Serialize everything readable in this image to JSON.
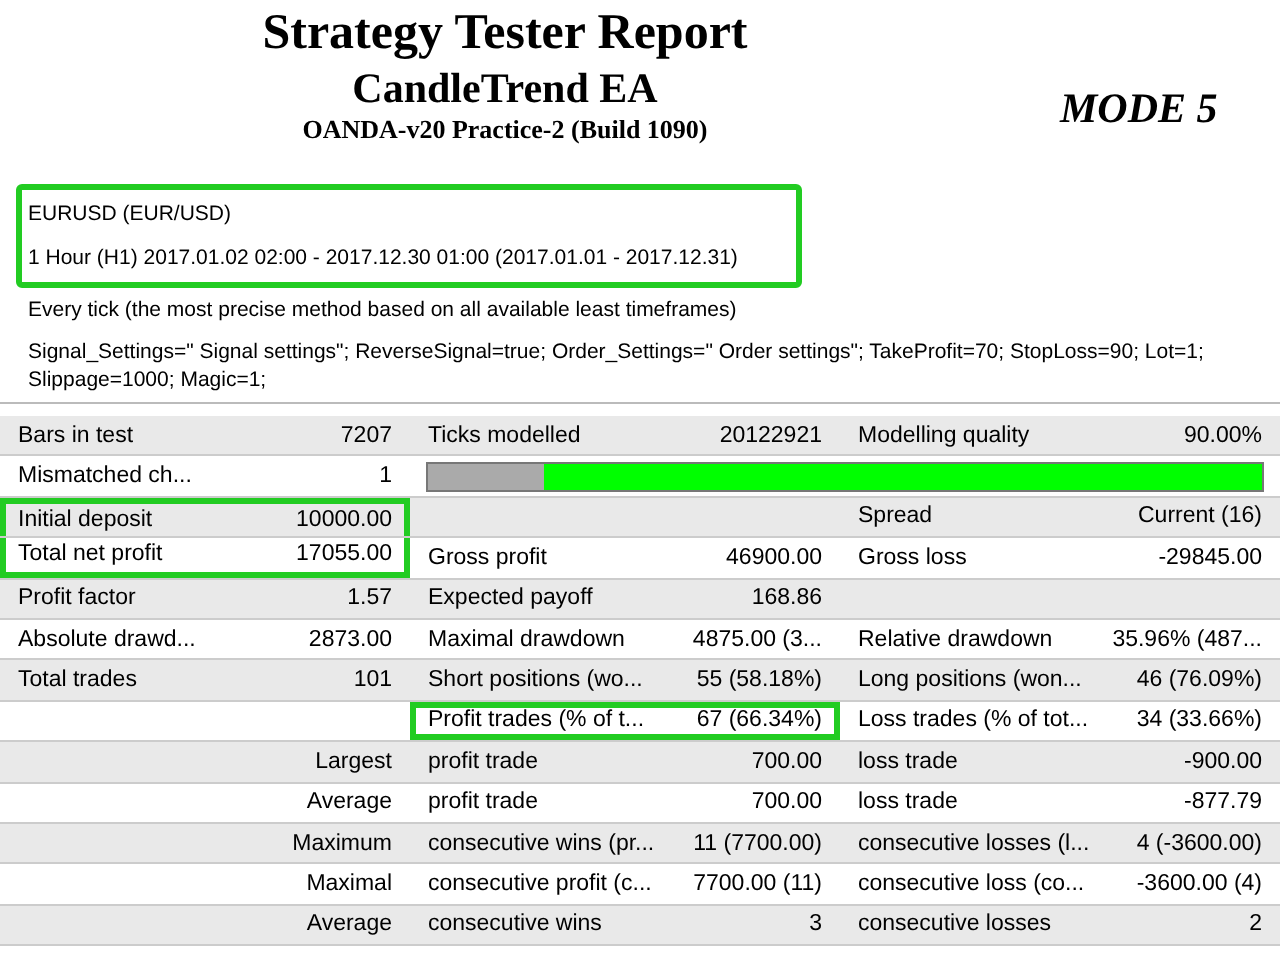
{
  "title": "Strategy Tester Report",
  "subtitle": "CandleTrend EA",
  "server": "OANDA-v20 Practice-2 (Build 1090)",
  "mode": "MODE 5",
  "info": [
    {
      "text": "EURUSD (EUR/USD)",
      "boxed": true
    },
    {
      "text": "1 Hour (H1) 2017.01.02 02:00 - 2017.12.30 01:00 (2017.01.01 - 2017.12.31)",
      "boxed": true
    },
    {
      "text": "Every tick (the most precise method based on all available least timeframes)",
      "boxed": false
    }
  ],
  "parameters": "Signal_Settings=\" Signal settings\"; ReverseSignal=true; Order_Settings=\" Order settings\"; TakeProfit=70; StopLoss=90; Lot=1; Slippage=1000; Magic=1;",
  "rows": [
    {
      "kind": "stats",
      "groups": [
        {
          "label": "Bars in test",
          "value": "7207",
          "boxed": false
        },
        {
          "label": "Ticks modelled",
          "value": "20122921",
          "boxed": false
        },
        {
          "label": "Modelling quality",
          "value": "90.00%",
          "boxed": false
        }
      ]
    },
    {
      "kind": "quality",
      "groups": [
        {
          "label": "Mismatched ch...",
          "value": "1",
          "boxed": false
        }
      ],
      "level": 0.14
    },
    {
      "kind": "stats",
      "groups": [
        {
          "label": "Initial deposit",
          "value": "10000.00",
          "boxed": true
        },
        {
          "boxed": false
        },
        {
          "label": "Spread",
          "value": "Current (16)",
          "boxed": false
        }
      ]
    },
    {
      "kind": "stats",
      "groups": [
        {
          "label": "Total net profit",
          "value": "17055.00",
          "boxed": true
        },
        {
          "label": "Gross profit",
          "value": "46900.00",
          "boxed": false
        },
        {
          "label": "Gross loss",
          "value": "-29845.00",
          "boxed": false
        }
      ]
    },
    {
      "kind": "stats",
      "groups": [
        {
          "label": "Profit factor",
          "value": "1.57",
          "boxed": false
        },
        {
          "label": "Expected payoff",
          "value": "168.86",
          "boxed": false
        },
        {
          "boxed": false
        }
      ]
    },
    {
      "kind": "stats",
      "groups": [
        {
          "label": "Absolute drawd...",
          "value": "2873.00",
          "boxed": false
        },
        {
          "label": "Maximal drawdown",
          "value": "4875.00 (3...",
          "boxed": false
        },
        {
          "label": "Relative drawdown",
          "value": "35.96% (487...",
          "boxed": false
        }
      ]
    },
    {
      "kind": "stats",
      "groups": [
        {
          "label": "Total trades",
          "value": "101",
          "boxed": false
        },
        {
          "label": "Short positions (wo...",
          "value": "55 (58.18%)",
          "boxed": false
        },
        {
          "label": "Long positions (won...",
          "value": "46 (76.09%)",
          "boxed": false
        }
      ]
    },
    {
      "kind": "stats",
      "groups": [
        {
          "boxed": false
        },
        {
          "label": "Profit trades (% of t...",
          "value": "67 (66.34%)",
          "boxed": true
        },
        {
          "label": "Loss trades (% of tot...",
          "value": "34 (33.66%)",
          "boxed": false
        }
      ]
    },
    {
      "kind": "stats",
      "groups": [
        {
          "value": "Largest",
          "boxed": false
        },
        {
          "label": "profit trade",
          "value": "700.00",
          "boxed": false
        },
        {
          "label": "loss trade",
          "value": "-900.00",
          "boxed": false
        }
      ]
    },
    {
      "kind": "stats",
      "groups": [
        {
          "value": "Average",
          "boxed": false
        },
        {
          "label": "profit trade",
          "value": "700.00",
          "boxed": false
        },
        {
          "label": "loss trade",
          "value": "-877.79",
          "boxed": false
        }
      ]
    },
    {
      "kind": "stats",
      "groups": [
        {
          "value": "Maximum",
          "boxed": false
        },
        {
          "label": "consecutive wins (pr...",
          "value": "11 (7700.00)",
          "boxed": false
        },
        {
          "label": "consecutive losses (l...",
          "value": "4 (-3600.00)",
          "boxed": false
        }
      ]
    },
    {
      "kind": "stats",
      "groups": [
        {
          "value": "Maximal",
          "boxed": false
        },
        {
          "label": "consecutive profit (c...",
          "value": "7700.00 (11)",
          "boxed": false
        },
        {
          "label": "consecutive loss (co...",
          "value": "-3600.00 (4)",
          "boxed": false
        }
      ]
    },
    {
      "kind": "stats",
      "groups": [
        {
          "value": "Average",
          "boxed": false
        },
        {
          "label": "consecutive wins",
          "value": "3",
          "boxed": false
        },
        {
          "label": "consecutive losses",
          "value": "2",
          "boxed": false
        }
      ]
    }
  ]
}
